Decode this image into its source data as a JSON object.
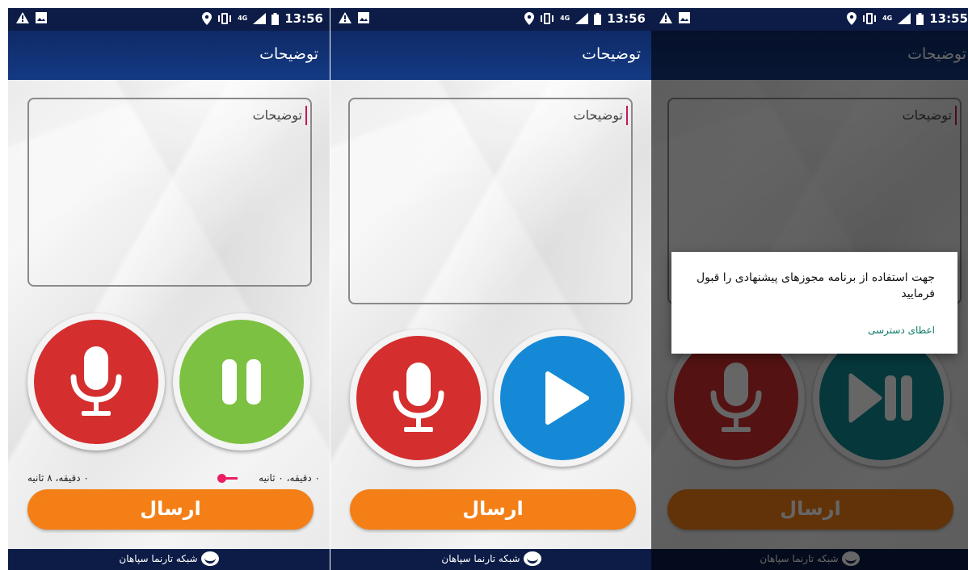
{
  "status_bar": {
    "panel1_time": "13:56",
    "panel2_time": "13:56",
    "panel3_time": "13:55",
    "network": "4G"
  },
  "app_title": "توضیحات",
  "description": {
    "placeholder": "توضیحات"
  },
  "recorder": {
    "elapsed": "۰ دقیقه، ۰ ثانیه",
    "total": "۰ دقیقه، ۸ ثانیه"
  },
  "send_label": "ارسال",
  "footer_text": "شبکه تارنما سپاهان",
  "permission_dialog": {
    "message": "جهت استفاده از برنامه مجوزهای پیشنهادی را قبول فرمایید",
    "action": "اعطای دسترسی"
  },
  "colors": {
    "mic": "#d42e2e",
    "pause": "#7dc142",
    "play": "#1689d6",
    "play_pause_teal": "#0e8b93",
    "send": "#f47f17",
    "header": "#0c1c47"
  },
  "icons": [
    "warning-icon",
    "image-icon",
    "location-icon",
    "vibrate-icon",
    "signal-icon",
    "battery-icon",
    "microphone-icon",
    "pause-icon",
    "play-icon",
    "play-pause-icon",
    "logo-icon"
  ]
}
